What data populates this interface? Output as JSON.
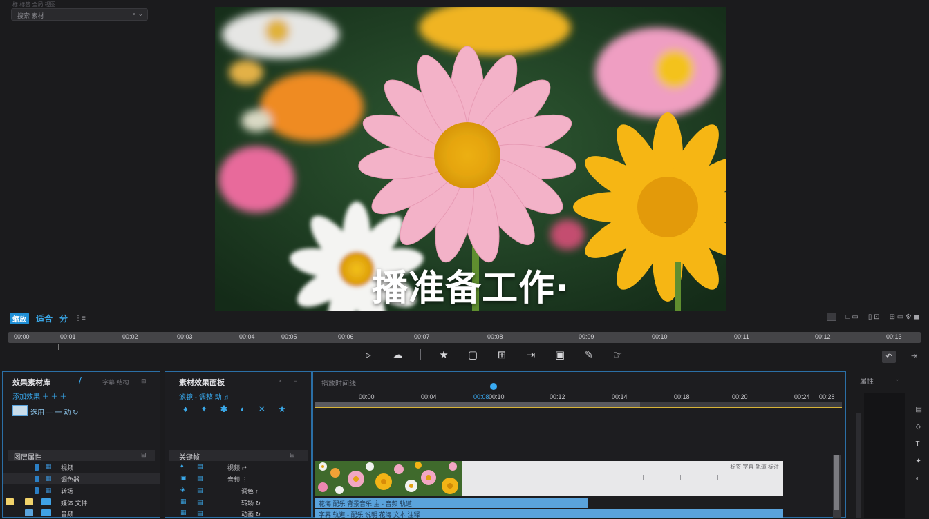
{
  "top_caption": "标 标签 全局 视图",
  "search": {
    "text": "搜索 素材",
    "icon": "filter-icon",
    "icon_glyph": "⌕ ⌄"
  },
  "preview": {
    "caption": "播准备工作·"
  },
  "playback_tools": {
    "zoom_label": "缩放",
    "fit_label": "适合",
    "split_label": "分",
    "more_label": "⋮≡"
  },
  "right_tools": [
    "□ ▭",
    "▯ ⊡",
    "⊞ ▭ ⚙ ◼"
  ],
  "ruler_labels": [
    "00:00",
    "00:01",
    "00:02",
    "00:03",
    "00:04",
    "00:05",
    "00:06",
    "00:07",
    "00:08",
    "00:09",
    "00:10",
    "00:11",
    "00:12",
    "00:13"
  ],
  "center_tools": [
    "▹",
    "☁",
    "★",
    "▢",
    "⊞",
    "⇥",
    "▣",
    "✎",
    "☞"
  ],
  "panel1": {
    "title": "效果素材库",
    "tab2": "字幕 结构",
    "sub_link": "添加效果 ＋ ＋ ＋",
    "item": "选用 — 一 动 ↻",
    "list_title": "图层属性",
    "rows": [
      "视频",
      "调色器",
      "转场",
      "媒体 文件",
      "音频"
    ]
  },
  "panel2": {
    "title": "素材效果面板",
    "sub_link": "滤镜 - 调整 动 ♫",
    "list_title": "关键帧",
    "rows": [
      "视频 ⇄",
      "音频 ⋮",
      "调色 ↑",
      "转场 ↻",
      "动画 ↻"
    ]
  },
  "panel3": {
    "title": "播放时间线",
    "time_labels": [
      "00:00",
      "00:04",
      "00:08",
      "00:10",
      "00:12",
      "00:14",
      "00:18",
      "00:20",
      "00:24",
      "00:28"
    ],
    "clip_label": "标签 字幕 轨道 标注",
    "audio_label": "花海 配乐 背景音乐 主 - 音频 轨道",
    "audio_label2": "字幕 轨道 - 配乐 说明 花海 文本 注释"
  },
  "panel4": {
    "title": "属性"
  }
}
